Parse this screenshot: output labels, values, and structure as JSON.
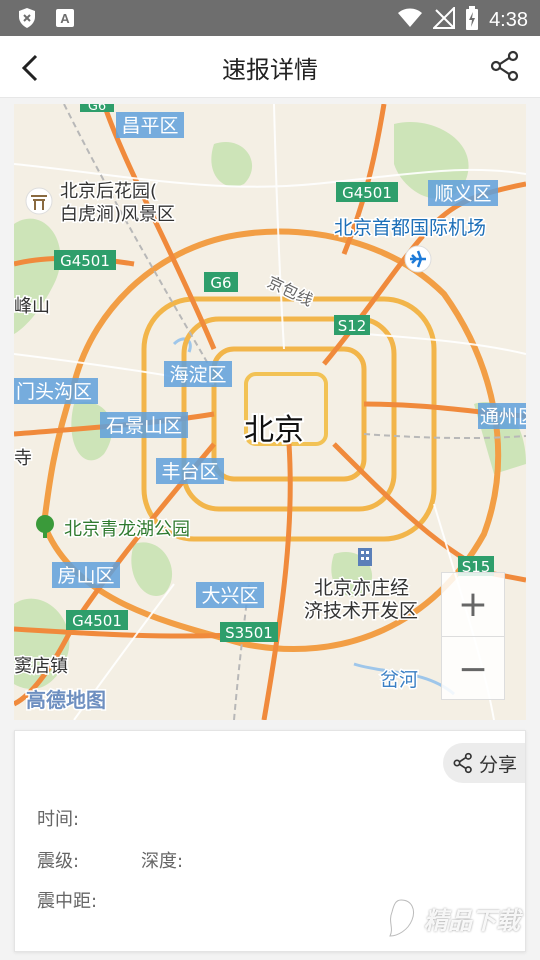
{
  "status_bar": {
    "time": "4:38"
  },
  "header": {
    "title": "速报详情"
  },
  "map": {
    "labels": {
      "changping": "昌平区",
      "g6_top": "G6",
      "houhuayuan_1": "北京后花园(",
      "houhuayuan_2": "白虎涧)风景区",
      "g4501_top": "G4501",
      "shunyi": "顺义区",
      "airport": "北京首都国际机场",
      "g4501_left": "G4501",
      "g6": "G6",
      "jingbao": "京包线",
      "fengshan": "峰山",
      "s12": "S12",
      "haidian": "海淀区",
      "mentougou": "门头沟区",
      "tongzhou": "通州区",
      "shijingshan": "石景山区",
      "beijing": "北京",
      "si": "寺",
      "fengtai": "丰台区",
      "qinglonghu": "北京青龙湖公园",
      "fangshan": "房山区",
      "s15": "S15",
      "daxing": "大兴区",
      "yizhuang_1": "北京亦庄经",
      "yizhuang_2": "济技术开发区",
      "g4501_bottom": "G4501",
      "s3501": "S3501",
      "dianzhen": "窦店镇",
      "chahe": "岔河",
      "logo": "高德地图"
    }
  },
  "zoom": {
    "in": "+",
    "out": "−"
  },
  "card": {
    "share_label": "分享",
    "time_label": "时间:",
    "magnitude_label": "震级:",
    "depth_label": "深度:",
    "distance_label": "震中距:"
  },
  "watermark": {
    "text": "精品下载"
  },
  "icons": [
    "shield-x-icon",
    "a-badge-icon",
    "wifi-icon",
    "no-signal-icon",
    "battery-icon",
    "back-arrow-icon",
    "share-icon",
    "airport-plane-icon",
    "park-tree-icon",
    "building-icon"
  ]
}
